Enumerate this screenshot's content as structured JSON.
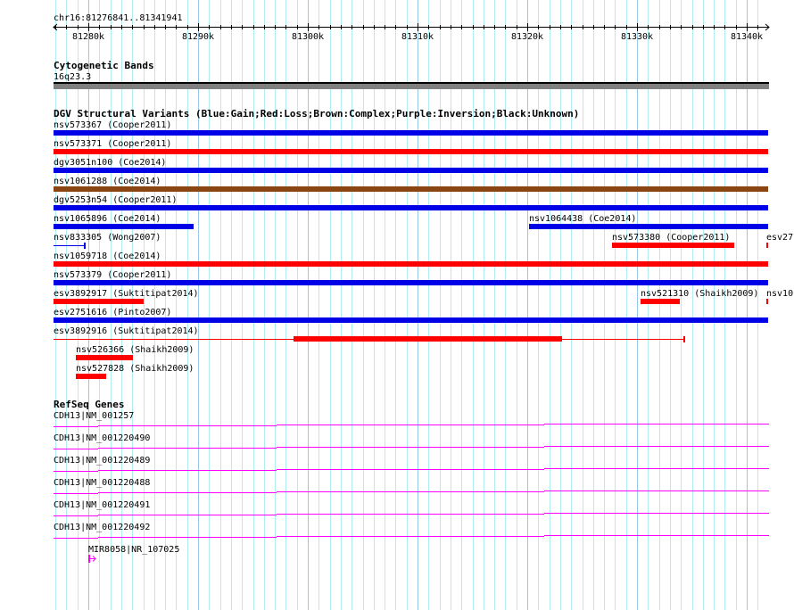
{
  "region": {
    "label": "chr16:81276841..81341941",
    "start_kb": 81276.841,
    "end_kb": 81341.941,
    "ticks": [
      "81280k",
      "81290k",
      "81300k",
      "81310k",
      "81320k",
      "81330k",
      "81340k"
    ]
  },
  "cytoband": {
    "title": "Cytogenetic Bands",
    "band": "16q23.3",
    "color": "#808080"
  },
  "dgv": {
    "title": "DGV Structural Variants (Blue:Gain;Red:Loss;Brown:Complex;Purple:Inversion;Black:Unknown)",
    "colors": {
      "gain": "#0000e6",
      "loss": "#ff0000",
      "complex": "#8b4513"
    },
    "rows": [
      [
        {
          "label": "nsv573367 (Cooper2011)",
          "type": "gain",
          "s": 81276.841,
          "e": 81341.941
        }
      ],
      [
        {
          "label": "nsv573371 (Cooper2011)",
          "type": "loss",
          "s": 81276.841,
          "e": 81341.941
        }
      ],
      [
        {
          "label": "dgv3051n100 (Coe2014)",
          "type": "gain",
          "s": 81276.841,
          "e": 81341.941
        }
      ],
      [
        {
          "label": "nsv1061288 (Coe2014)",
          "type": "complex",
          "s": 81276.841,
          "e": 81341.941
        }
      ],
      [
        {
          "label": "dgv5253n54 (Cooper2011)",
          "type": "gain",
          "s": 81276.841,
          "e": 81341.941
        }
      ],
      [
        {
          "label": "nsv1065896 (Coe2014)",
          "type": "gain",
          "s": 81276.841,
          "e": 81289.6
        },
        {
          "label": "nsv1064438 (Coe2014)",
          "type": "gain",
          "s": 81320.2,
          "e": 81341.941
        }
      ],
      [
        {
          "label": "nsv833305 (Wong2007)",
          "type": "gain",
          "s": 81276.841,
          "e": 81279.7,
          "thin": true
        },
        {
          "label": "nsv573380 (Cooper2011)",
          "type": "loss",
          "s": 81327.7,
          "e": 81338.9
        },
        {
          "label": "esv27",
          "type": "loss",
          "s": 81341.8,
          "e": 81341.941
        }
      ],
      [
        {
          "label": "nsv1059718 (Coe2014)",
          "type": "loss",
          "s": 81276.841,
          "e": 81341.941
        }
      ],
      [
        {
          "label": "nsv573379 (Cooper2011)",
          "type": "gain",
          "s": 81276.841,
          "e": 81341.941
        }
      ],
      [
        {
          "label": "esv3892917 (Suktitipat2014)",
          "type": "loss",
          "s": 81276.841,
          "e": 81285.0
        },
        {
          "label": "nsv521310 (Shaikh2009)",
          "type": "loss",
          "s": 81330.3,
          "e": 81333.9
        },
        {
          "label": "nsv10",
          "type": "loss",
          "s": 81341.8,
          "e": 81341.941
        }
      ],
      [
        {
          "label": "esv2751616 (Pinto2007)",
          "type": "gain",
          "s": 81276.841,
          "e": 81341.941
        }
      ],
      [
        {
          "label": "esv3892916 (Suktitipat2014)",
          "type": "loss",
          "s": 81276.841,
          "e": 81334.3,
          "thin": true,
          "thick_s": 81298.7,
          "thick_e": 81323.2
        }
      ],
      [
        {
          "label": "nsv526366 (Shaikh2009)",
          "type": "loss",
          "s": 81278.9,
          "e": 81284.1
        }
      ],
      [
        {
          "label": "nsv527828 (Shaikh2009)",
          "type": "loss",
          "s": 81278.9,
          "e": 81281.6
        }
      ]
    ]
  },
  "genes": {
    "title": "RefSeq Genes",
    "color": "#ff00ff",
    "items": [
      "CDH13|NM_001257",
      "CDH13|NM_001220490",
      "CDH13|NM_001220489",
      "CDH13|NM_001220488",
      "CDH13|NM_001220491",
      "CDH13|NM_001220492"
    ],
    "mir": {
      "label": "MIR8058|NR_107025",
      "s": 81280.0
    }
  }
}
